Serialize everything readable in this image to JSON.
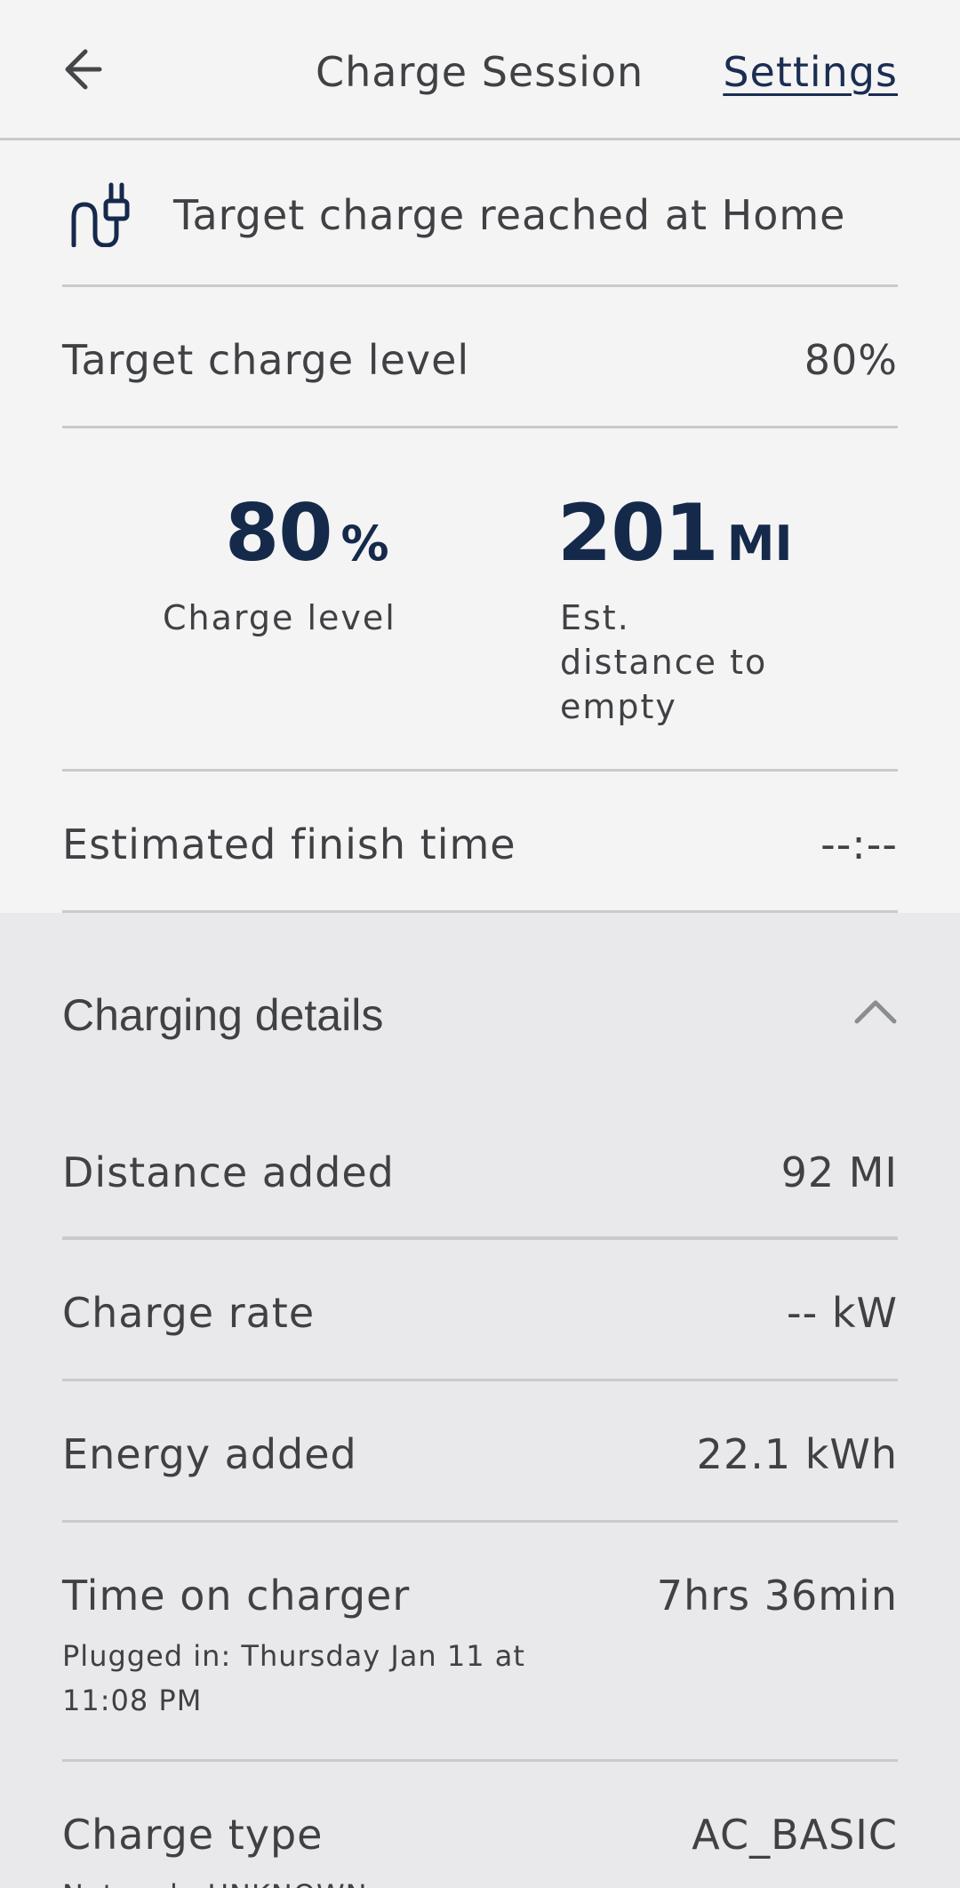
{
  "header": {
    "title": "Charge Session",
    "settings_label": "Settings"
  },
  "icons": {
    "back": "arrow-left-icon",
    "plug": "charging-plug-icon",
    "collapse": "chevron-up-icon"
  },
  "colors": {
    "accent_navy": "#15294b",
    "link": "#1b2d52",
    "text": "#3f4144",
    "divider": "#c9cacc",
    "background": "#f4f4f4",
    "panel_background": "#e9e9eb"
  },
  "status": {
    "message": "Target charge reached at Home"
  },
  "target_charge": {
    "label": "Target charge level",
    "value": "80%"
  },
  "stats": {
    "charge_value": "80",
    "charge_unit": "%",
    "charge_label": "Charge level",
    "range_value": "201",
    "range_unit": "MI",
    "range_label_lines": [
      "Est.",
      "distance to",
      "empty"
    ]
  },
  "finish_time": {
    "label": "Estimated finish time",
    "value": "--:--"
  },
  "details": {
    "title": "Charging details",
    "rows": [
      {
        "label": "Distance added",
        "value": "92 MI"
      },
      {
        "label": "Charge rate",
        "value": "-- kW"
      },
      {
        "label": "Energy added",
        "value": "22.1 kWh"
      },
      {
        "label": "Time on charger",
        "value": "7hrs 36min",
        "sub_lines": [
          "Plugged in: Thursday Jan 11 at",
          "11:08 PM"
        ]
      },
      {
        "label": "Charge type",
        "value": "AC_BASIC",
        "sub": "Network: UNKNOWN"
      }
    ]
  }
}
